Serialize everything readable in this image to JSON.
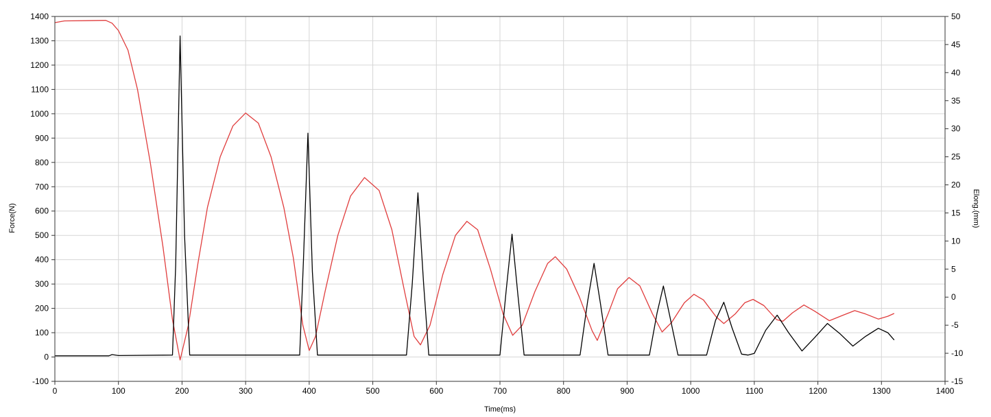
{
  "chart_data": {
    "type": "line",
    "xlabel": "Time(ms)",
    "ylabel": "Force(N)",
    "y2label": "Elong.(mm)",
    "xlim": [
      0,
      1400
    ],
    "ylim": [
      -100,
      1400
    ],
    "y2lim": [
      -15,
      50
    ],
    "grid": true,
    "x_ticks": [
      "0",
      "100",
      "200",
      "300",
      "400",
      "500",
      "600",
      "700",
      "800",
      "900",
      "1000",
      "1100",
      "1200",
      "1300",
      "1400"
    ],
    "y_ticks": [
      "-100",
      "0",
      "100",
      "200",
      "300",
      "400",
      "500",
      "600",
      "700",
      "800",
      "900",
      "1000",
      "1100",
      "1200",
      "1300",
      "1400"
    ],
    "y2_ticks": [
      "-15",
      "-10",
      "-5",
      "0",
      "5",
      "10",
      "15",
      "20",
      "25",
      "30",
      "35",
      "40",
      "45",
      "50"
    ],
    "series": [
      {
        "axis": "left",
        "color": "#000000",
        "points": [
          [
            0,
            5
          ],
          [
            85,
            5
          ],
          [
            90,
            10
          ],
          [
            100,
            6
          ],
          [
            185,
            8
          ],
          [
            190,
            380
          ],
          [
            197,
            1320
          ],
          [
            204,
            500
          ],
          [
            212,
            8
          ],
          [
            385,
            8
          ],
          [
            391,
            400
          ],
          [
            398,
            920
          ],
          [
            405,
            350
          ],
          [
            413,
            8
          ],
          [
            553,
            8
          ],
          [
            562,
            300
          ],
          [
            571,
            675
          ],
          [
            580,
            300
          ],
          [
            588,
            8
          ],
          [
            700,
            8
          ],
          [
            710,
            280
          ],
          [
            719,
            505
          ],
          [
            728,
            260
          ],
          [
            738,
            8
          ],
          [
            826,
            8
          ],
          [
            838,
            230
          ],
          [
            848,
            385
          ],
          [
            858,
            220
          ],
          [
            870,
            8
          ],
          [
            935,
            8
          ],
          [
            947,
            180
          ],
          [
            957,
            292
          ],
          [
            967,
            170
          ],
          [
            980,
            8
          ],
          [
            1025,
            8
          ],
          [
            1039,
            150
          ],
          [
            1052,
            225
          ],
          [
            1065,
            120
          ],
          [
            1080,
            12
          ],
          [
            1090,
            8
          ],
          [
            1100,
            15
          ],
          [
            1118,
            110
          ],
          [
            1136,
            172
          ],
          [
            1154,
            100
          ],
          [
            1175,
            25
          ],
          [
            1195,
            80
          ],
          [
            1215,
            138
          ],
          [
            1235,
            95
          ],
          [
            1255,
            45
          ],
          [
            1275,
            85
          ],
          [
            1295,
            118
          ],
          [
            1310,
            100
          ],
          [
            1320,
            70
          ]
        ]
      },
      {
        "axis": "right",
        "color": "#e03c3c",
        "points": [
          [
            0,
            48.9
          ],
          [
            15,
            49.2
          ],
          [
            80,
            49.3
          ],
          [
            90,
            48.8
          ],
          [
            100,
            47.5
          ],
          [
            115,
            44
          ],
          [
            130,
            37
          ],
          [
            150,
            24
          ],
          [
            170,
            9
          ],
          [
            185,
            -4
          ],
          [
            197,
            -11.2
          ],
          [
            210,
            -5
          ],
          [
            225,
            6
          ],
          [
            240,
            16
          ],
          [
            260,
            25
          ],
          [
            280,
            30.5
          ],
          [
            300,
            32.8
          ],
          [
            320,
            31
          ],
          [
            340,
            25
          ],
          [
            360,
            16
          ],
          [
            375,
            7
          ],
          [
            390,
            -5
          ],
          [
            400,
            -9.5
          ],
          [
            410,
            -7
          ],
          [
            425,
            1
          ],
          [
            445,
            11
          ],
          [
            465,
            18
          ],
          [
            487,
            21.3
          ],
          [
            510,
            19
          ],
          [
            530,
            12
          ],
          [
            550,
            1
          ],
          [
            565,
            -7
          ],
          [
            575,
            -8.5
          ],
          [
            590,
            -5
          ],
          [
            610,
            4
          ],
          [
            630,
            11
          ],
          [
            648,
            13.5
          ],
          [
            665,
            12
          ],
          [
            685,
            5
          ],
          [
            705,
            -3
          ],
          [
            720,
            -6.8
          ],
          [
            735,
            -5
          ],
          [
            755,
            1
          ],
          [
            775,
            6
          ],
          [
            787,
            7.2
          ],
          [
            805,
            5
          ],
          [
            825,
            0
          ],
          [
            845,
            -6
          ],
          [
            853,
            -7.7
          ],
          [
            870,
            -3
          ],
          [
            885,
            1.5
          ],
          [
            903,
            3.5
          ],
          [
            920,
            2
          ],
          [
            940,
            -3
          ],
          [
            955,
            -6.2
          ],
          [
            970,
            -4.5
          ],
          [
            990,
            -1
          ],
          [
            1005,
            0.5
          ],
          [
            1020,
            -0.5
          ],
          [
            1040,
            -3.5
          ],
          [
            1052,
            -4.7
          ],
          [
            1070,
            -3
          ],
          [
            1085,
            -1
          ],
          [
            1098,
            -0.4
          ],
          [
            1115,
            -1.5
          ],
          [
            1135,
            -4
          ],
          [
            1145,
            -4.3
          ],
          [
            1160,
            -2.8
          ],
          [
            1178,
            -1.4
          ],
          [
            1195,
            -2.5
          ],
          [
            1218,
            -4.2
          ],
          [
            1240,
            -3.2
          ],
          [
            1258,
            -2.4
          ],
          [
            1275,
            -3
          ],
          [
            1295,
            -3.9
          ],
          [
            1310,
            -3.4
          ],
          [
            1320,
            -2.9
          ]
        ]
      }
    ]
  }
}
